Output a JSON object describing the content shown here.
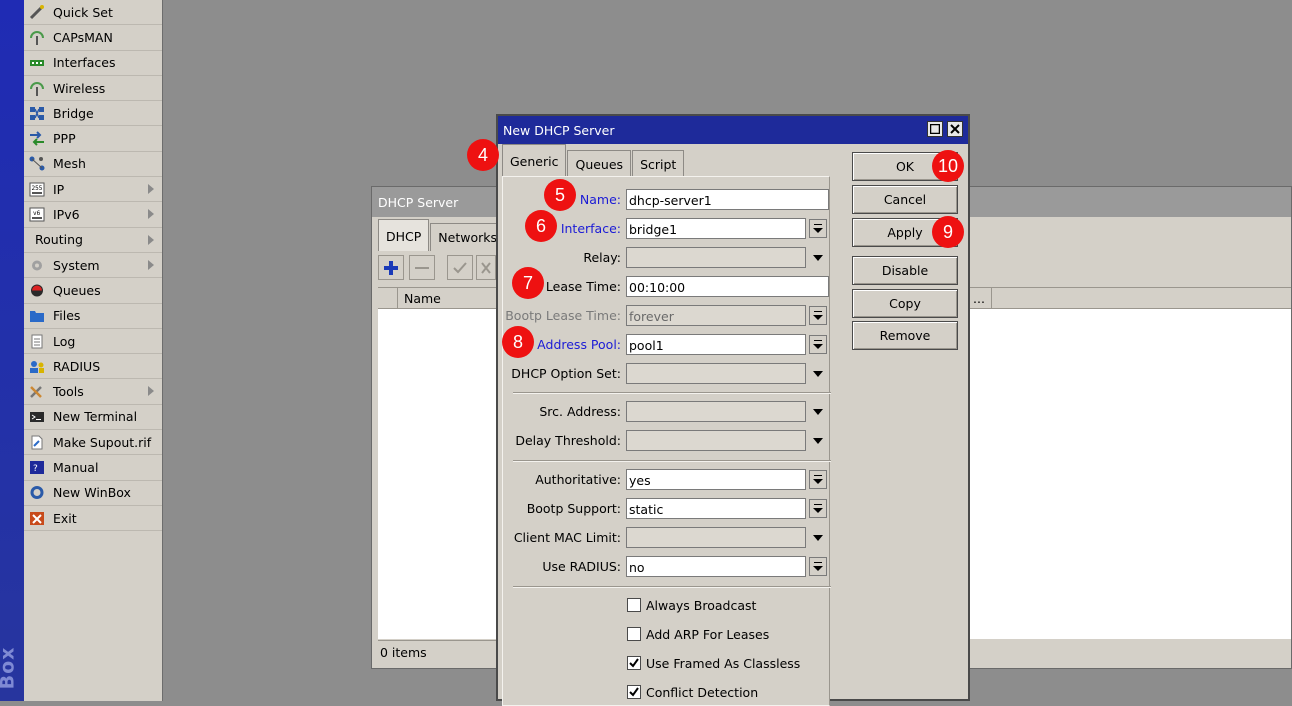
{
  "brand": {
    "text": "Box"
  },
  "side_menu": {
    "items": [
      {
        "label": "Quick Set",
        "icon": "wand-icon",
        "submenu": false
      },
      {
        "label": "CAPsMAN",
        "icon": "antenna-icon",
        "submenu": false
      },
      {
        "label": "Interfaces",
        "icon": "interfaces-icon",
        "submenu": false
      },
      {
        "label": "Wireless",
        "icon": "antenna-icon",
        "submenu": false
      },
      {
        "label": "Bridge",
        "icon": "bridge-icon",
        "submenu": false
      },
      {
        "label": "PPP",
        "icon": "ppp-icon",
        "submenu": false
      },
      {
        "label": "Mesh",
        "icon": "mesh-icon",
        "submenu": false
      },
      {
        "label": "IP",
        "icon": "ip-icon",
        "submenu": true
      },
      {
        "label": "IPv6",
        "icon": "ipv6-icon",
        "submenu": true
      },
      {
        "label": "Routing",
        "icon": "",
        "submenu": true
      },
      {
        "label": "System",
        "icon": "gear-icon",
        "submenu": true
      },
      {
        "label": "Queues",
        "icon": "queues-icon",
        "submenu": false
      },
      {
        "label": "Files",
        "icon": "folder-icon",
        "submenu": false
      },
      {
        "label": "Log",
        "icon": "log-icon",
        "submenu": false
      },
      {
        "label": "RADIUS",
        "icon": "users-icon",
        "submenu": false
      },
      {
        "label": "Tools",
        "icon": "tools-icon",
        "submenu": true
      },
      {
        "label": "New Terminal",
        "icon": "terminal-icon",
        "submenu": false
      },
      {
        "label": "Make Supout.rif",
        "icon": "supout-icon",
        "submenu": false
      },
      {
        "label": "Manual",
        "icon": "manual-icon",
        "submenu": false
      },
      {
        "label": "New WinBox",
        "icon": "winbox-icon",
        "submenu": false
      },
      {
        "label": "Exit",
        "icon": "exit-icon",
        "submenu": false
      }
    ]
  },
  "dhcp_window": {
    "title": "DHCP Server",
    "tabs": [
      "DHCP",
      "Networks"
    ],
    "columns": [
      "Name",
      "..."
    ],
    "status": "0 items"
  },
  "dialog": {
    "title": "New DHCP Server",
    "tabs": [
      "Generic",
      "Queues",
      "Script"
    ],
    "fields": {
      "name": {
        "label": "Name:",
        "value": "dhcp-server1"
      },
      "interface": {
        "label": "Interface:",
        "value": "bridge1"
      },
      "relay": {
        "label": "Relay:",
        "value": ""
      },
      "lease_time": {
        "label": "Lease Time:",
        "value": "00:10:00"
      },
      "bootp_lease_time": {
        "label": "Bootp Lease Time:",
        "value": "forever"
      },
      "address_pool": {
        "label": "Address Pool:",
        "value": "pool1"
      },
      "dhcp_option_set": {
        "label": "DHCP Option Set:",
        "value": ""
      },
      "src_address": {
        "label": "Src. Address:",
        "value": ""
      },
      "delay_threshold": {
        "label": "Delay Threshold:",
        "value": ""
      },
      "authoritative": {
        "label": "Authoritative:",
        "value": "yes"
      },
      "bootp_support": {
        "label": "Bootp Support:",
        "value": "static"
      },
      "client_mac_limit": {
        "label": "Client MAC Limit:",
        "value": ""
      },
      "use_radius": {
        "label": "Use RADIUS:",
        "value": "no"
      }
    },
    "checkboxes": [
      {
        "label": "Always Broadcast",
        "checked": false
      },
      {
        "label": "Add ARP For Leases",
        "checked": false
      },
      {
        "label": "Use Framed As Classless",
        "checked": true
      },
      {
        "label": "Conflict Detection",
        "checked": true
      }
    ],
    "buttons": {
      "ok": "OK",
      "cancel": "Cancel",
      "apply": "Apply",
      "disable": "Disable",
      "copy": "Copy",
      "remove": "Remove"
    }
  },
  "markers": [
    "4",
    "5",
    "6",
    "7",
    "8",
    "9",
    "10"
  ],
  "colors": {
    "marker": "#ee1111",
    "titlebar_active": "#1e2a9a",
    "link_label": "#1b1bd6"
  }
}
